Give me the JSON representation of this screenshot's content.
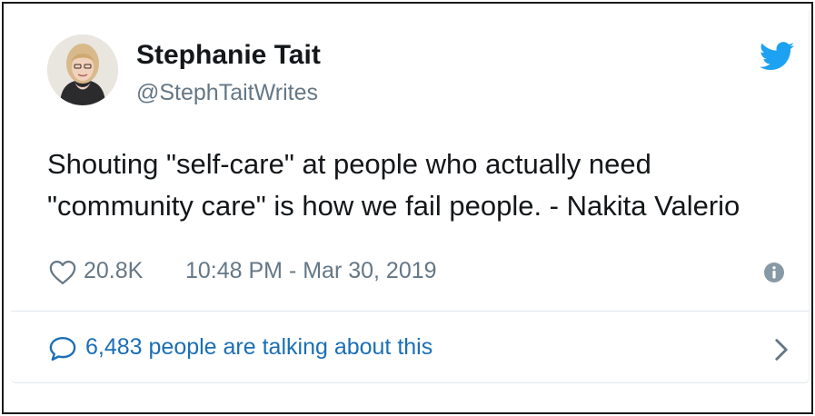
{
  "tweet": {
    "author": {
      "name": "Stephanie Tait",
      "handle": "@StephTaitWrites",
      "avatar_icon": "profile-photo"
    },
    "brand_icon": "twitter-bird-icon",
    "brand_color": "#1da1f2",
    "text_lines": [
      "Shouting \"self-care\" at people who actually need",
      "\"community care\" is how we fail people. - Nakita Valerio"
    ],
    "likes": "20.8K",
    "timestamp": "10:48 PM - Mar 30, 2019",
    "info_icon": "info-icon",
    "conversation": {
      "label": "6,483 people are talking about this",
      "link_color": "#1b6fb5"
    }
  }
}
